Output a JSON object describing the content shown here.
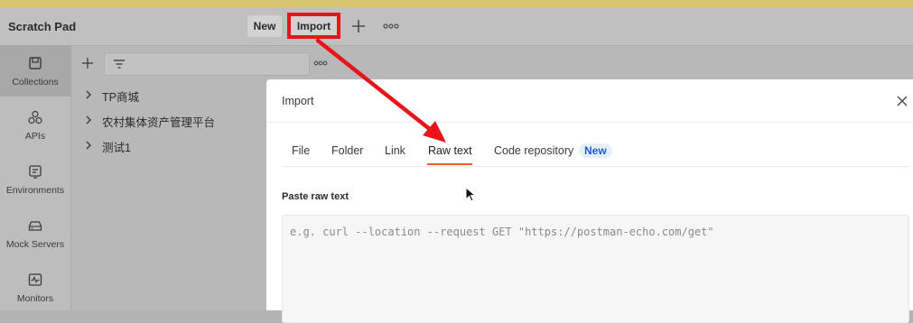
{
  "header": {
    "app_title": "Scratch Pad",
    "new_label": "New",
    "import_label": "Import"
  },
  "leftnav": {
    "items": [
      {
        "label": "Collections",
        "icon": "collections-icon",
        "active": true
      },
      {
        "label": "APIs",
        "icon": "apis-icon"
      },
      {
        "label": "Environments",
        "icon": "environments-icon"
      },
      {
        "label": "Mock Servers",
        "icon": "mock-servers-icon"
      },
      {
        "label": "Monitors",
        "icon": "monitors-icon"
      }
    ]
  },
  "collections": {
    "items": [
      {
        "label": "TP商城"
      },
      {
        "label": "农村集体资产管理平台"
      },
      {
        "label": "测试1"
      }
    ]
  },
  "modal": {
    "title": "Import",
    "tabs": [
      {
        "label": "File"
      },
      {
        "label": "Folder"
      },
      {
        "label": "Link"
      },
      {
        "label": "Raw text",
        "active": true
      },
      {
        "label": "Code repository"
      }
    ],
    "new_badge": "New",
    "section_label": "Paste raw text",
    "raw_placeholder": "e.g. curl --location --request GET \"https://postman-echo.com/get\""
  },
  "colors": {
    "annotation_red": "#e8141a",
    "tab_underline": "#ef5b25",
    "badge_text": "#1a5fcb"
  }
}
